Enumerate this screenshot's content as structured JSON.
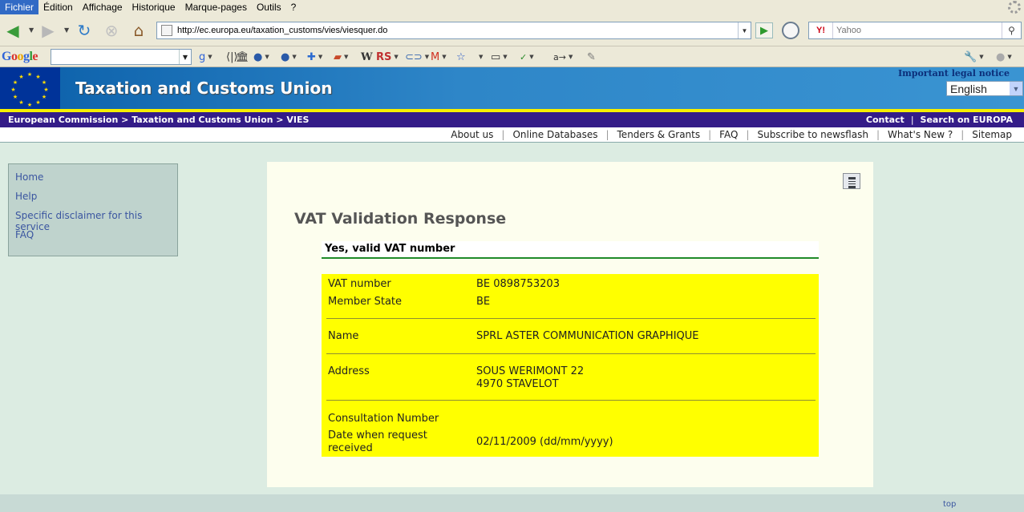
{
  "menu": {
    "items": [
      "Fichier",
      "Édition",
      "Affichage",
      "Historique",
      "Marque-pages",
      "Outils",
      "?"
    ]
  },
  "navigation": {
    "url": "http://ec.europa.eu/taxation_customs/vies/viesquer.do",
    "search_engine": "Y!",
    "search_placeholder": "Yahoo"
  },
  "google_toolbar": {
    "logo": "Google"
  },
  "banner": {
    "title": "Taxation and Customs Union",
    "legal_notice": "Important legal notice",
    "language": "English"
  },
  "breadcrumb": {
    "text": "European Commission > Taxation and Customs Union > VIES",
    "contact": "Contact",
    "search": "Search on EUROPA"
  },
  "toplinks": [
    "About us",
    "Online Databases",
    "Tenders & Grants",
    "FAQ",
    "Subscribe to newsflash",
    "What's New ?",
    "Sitemap"
  ],
  "sidebar": {
    "items": [
      "Home",
      "Help",
      "Specific disclaimer for this service",
      "FAQ"
    ]
  },
  "response": {
    "title": "VAT Validation Response",
    "status": "Yes, valid VAT number",
    "vat_number_label": "VAT number",
    "vat_number": "BE 0898753203",
    "member_state_label": "Member State",
    "member_state": "BE",
    "name_label": "Name",
    "name": "SPRL ASTER COMMUNICATION GRAPHIQUE",
    "address_label": "Address",
    "address_line1": "SOUS WERIMONT 22",
    "address_line2": "4970 STAVELOT",
    "consultation_label": "Consultation Number",
    "consultation_number": "",
    "date_label_line1": "Date when request",
    "date_label_line2": "received",
    "date_value": "02/11/2009 (dd/mm/yyyy)"
  },
  "footer": {
    "top_link": "top"
  },
  "colors": {
    "banner_blue": "#2e86c8",
    "purple_bar": "#341c88",
    "result_yellow": "#ffff00",
    "valid_green": "#1f8a2a",
    "page_bg": "#dcece2"
  }
}
